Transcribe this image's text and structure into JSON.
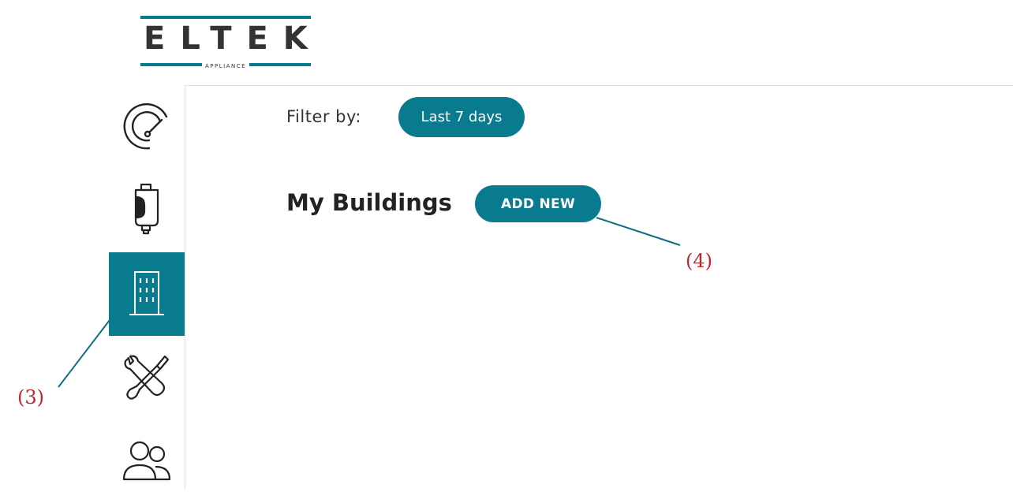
{
  "colors": {
    "accent": "#087b8e",
    "annotation": "#c0272d",
    "text": "#222222"
  },
  "logo": {
    "wordmark": "ELTEK",
    "subtitle": "APPLIANCE"
  },
  "sidebar": {
    "items": [
      {
        "icon": "gauge-icon",
        "active": false
      },
      {
        "icon": "water-heater-icon",
        "active": false
      },
      {
        "icon": "building-icon",
        "active": true
      },
      {
        "icon": "tools-icon",
        "active": false
      },
      {
        "icon": "users-icon",
        "active": false
      }
    ]
  },
  "filter": {
    "label": "Filter by:",
    "value": "Last 7 days"
  },
  "main": {
    "title": "My Buildings",
    "add_label": "ADD NEW"
  },
  "annotations": {
    "sidebar_marker": "(3)",
    "add_marker": "(4)"
  }
}
